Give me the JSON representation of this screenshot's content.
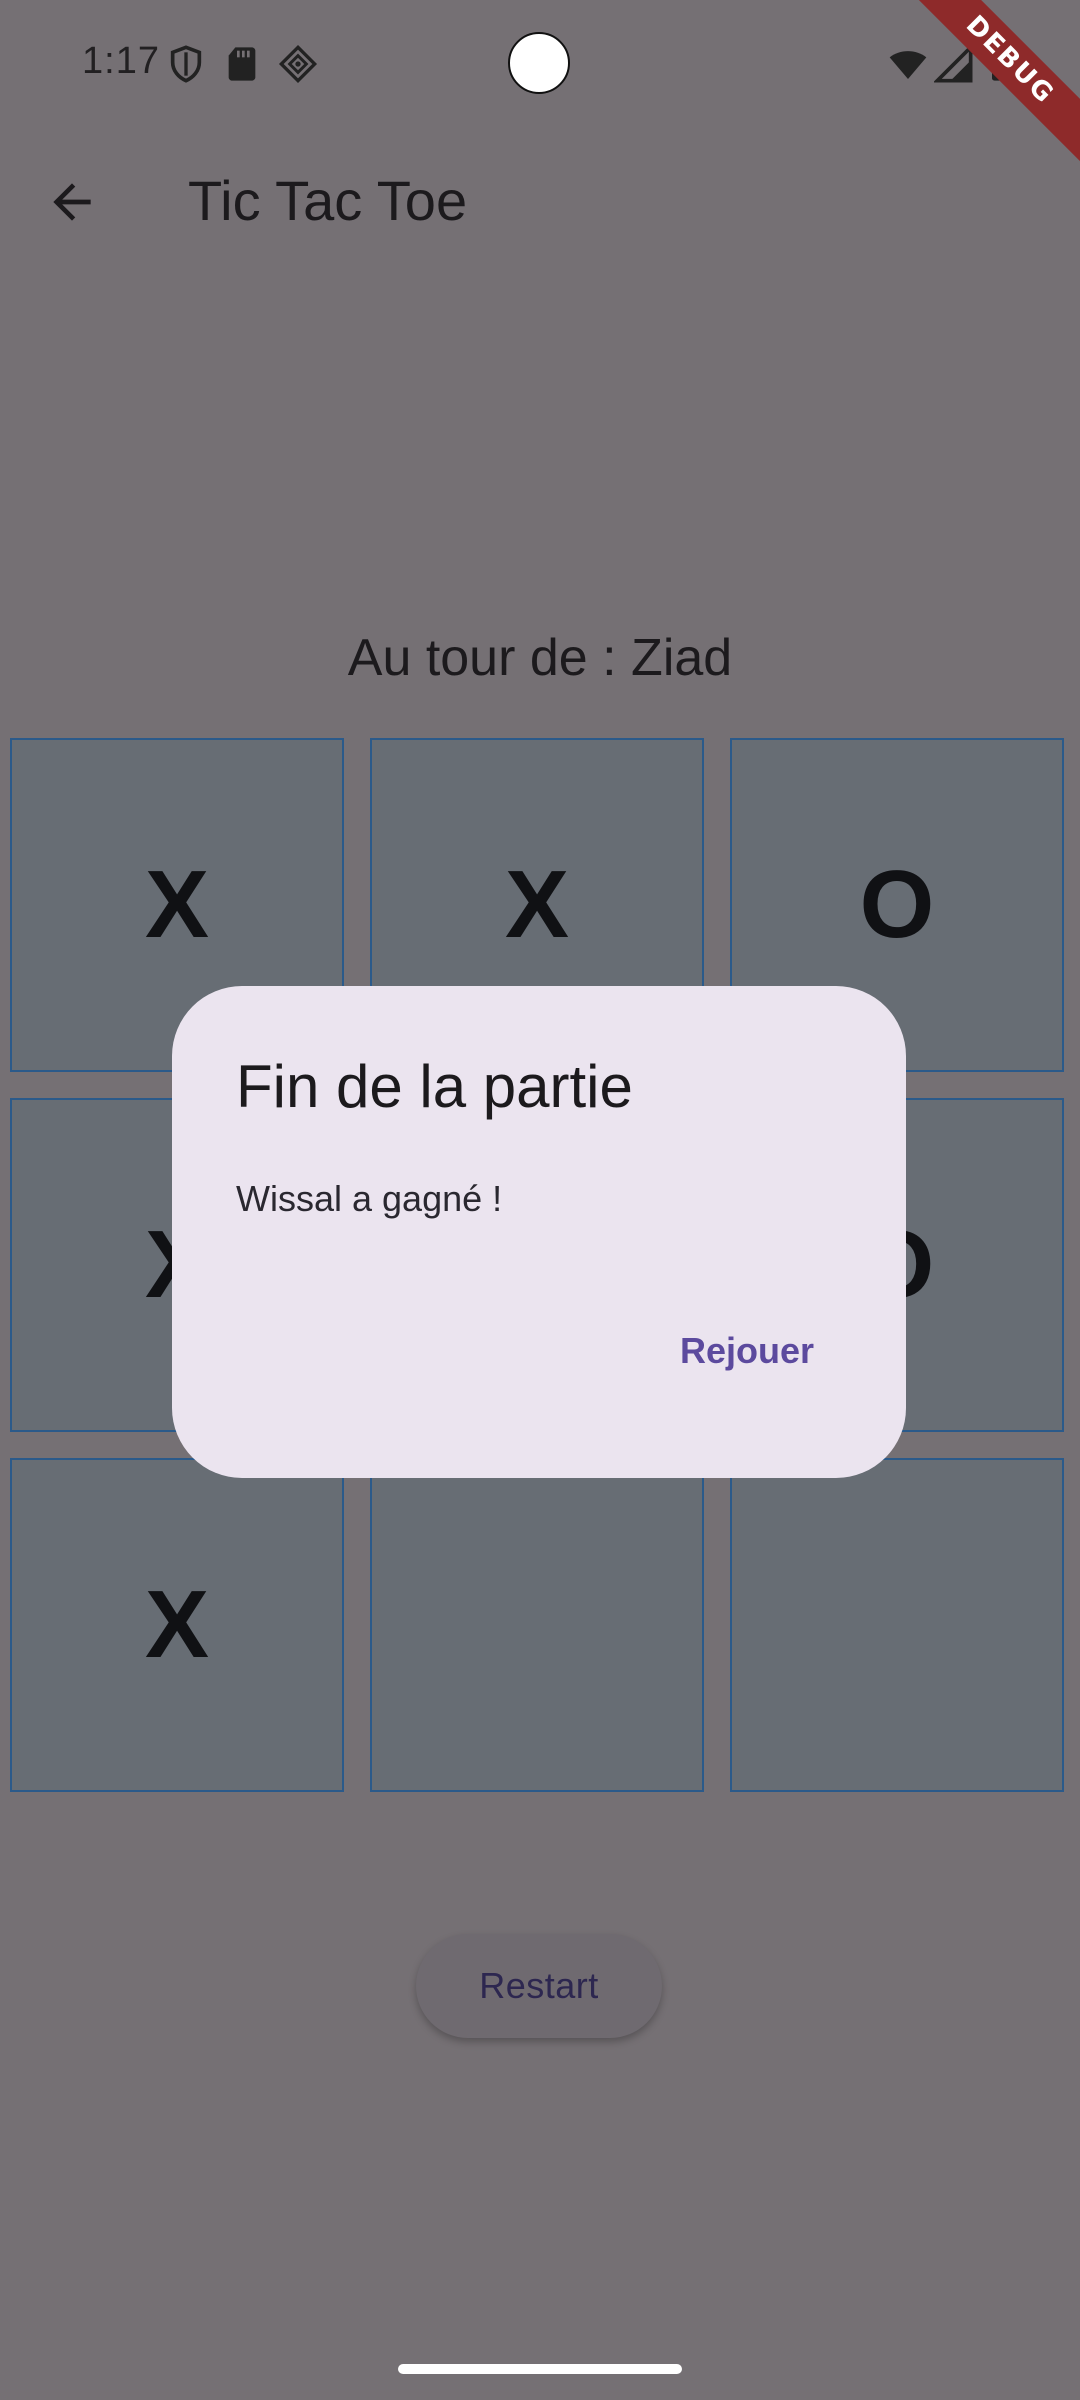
{
  "status_bar": {
    "time": "1:17",
    "left_icons": [
      "shield-icon",
      "sd-card-icon",
      "vpn-diamond-icon"
    ],
    "right_icons": [
      "wifi-icon",
      "signal-icon",
      "battery-icon"
    ]
  },
  "debug_banner": {
    "label": "DEBUG"
  },
  "app_bar": {
    "back_icon": "arrow-back-icon",
    "title": "Tic Tac Toe"
  },
  "game": {
    "turn_text": "Au tour de : Ziad",
    "board": {
      "rows": [
        [
          "X",
          "X",
          "O"
        ],
        [
          "X",
          "",
          "O"
        ],
        [
          "X",
          "",
          ""
        ]
      ]
    },
    "restart_label": "Restart"
  },
  "dialog": {
    "title": "Fin de la partie",
    "message": "Wissal a gagné !",
    "action_label": "Rejouer"
  },
  "colors": {
    "background": "#757074",
    "cell_fill": "#676d74",
    "cell_border": "#2b5a8a",
    "dialog_bg": "#ebe4ef",
    "accent": "#5c4a9e",
    "debug_red": "#8e2a2a"
  }
}
